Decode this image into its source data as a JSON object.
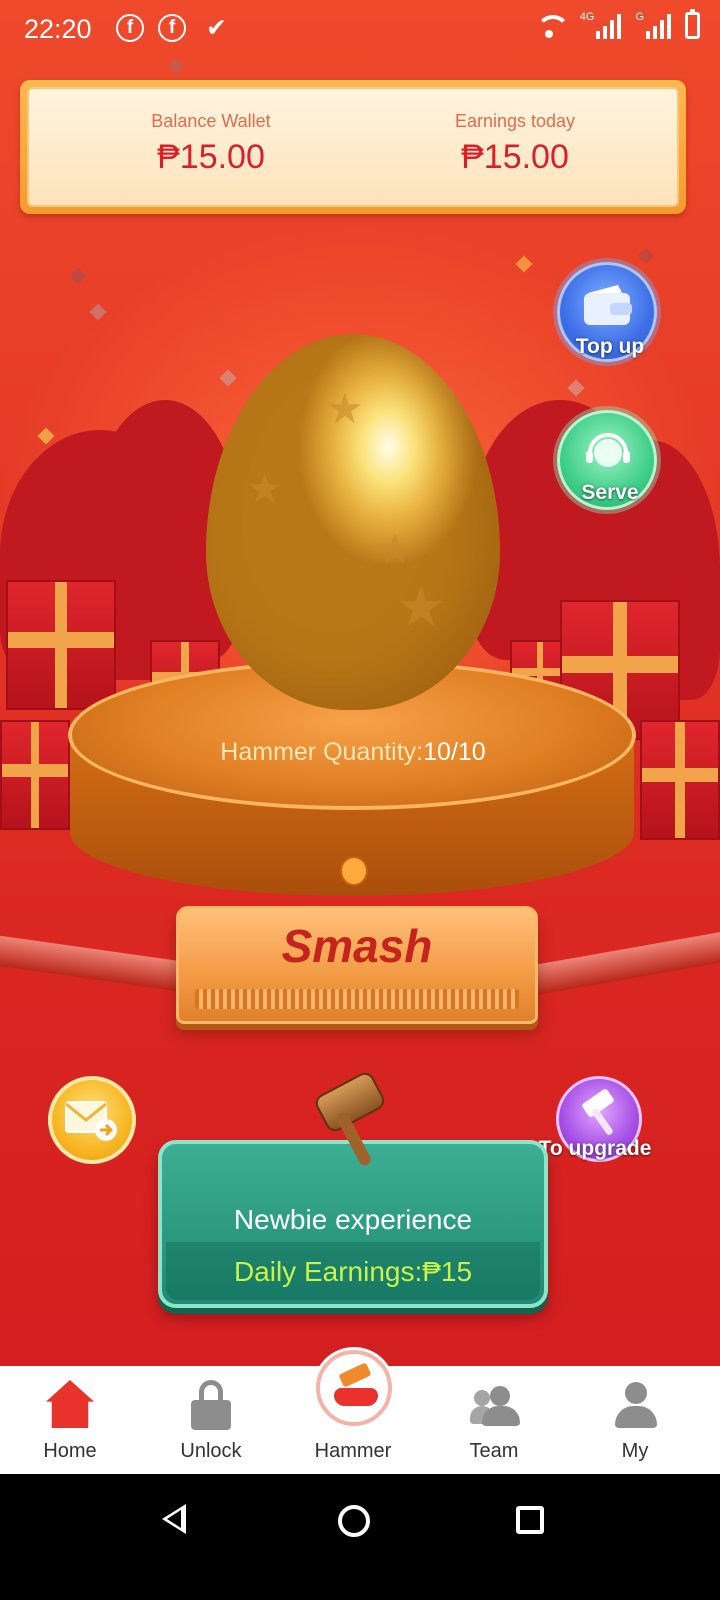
{
  "status_bar": {
    "time": "22:20",
    "notification_icons": [
      "facebook-icon",
      "facebook-icon",
      "download-done-icon"
    ],
    "network_labels": [
      "4G",
      "G"
    ]
  },
  "wallet": {
    "balance_label": "Balance Wallet",
    "balance_value": "₱15.00",
    "earnings_label": "Earnings today",
    "earnings_value": "₱15.00"
  },
  "side_buttons": {
    "top_up": "Top up",
    "serve": "Serve",
    "to_upgrade": "To upgrade"
  },
  "game": {
    "hammer_quantity_label": "Hammer Quantity:",
    "hammer_quantity_value": "10/10",
    "smash_label": "Smash"
  },
  "plan": {
    "title": "Newbie experience",
    "daily_earnings": "Daily Earnings:₱15"
  },
  "tabs": [
    {
      "label": "Home",
      "icon": "home-icon",
      "active": true
    },
    {
      "label": "Unlock",
      "icon": "lock-icon"
    },
    {
      "label": "Hammer",
      "icon": "hammer-icon"
    },
    {
      "label": "Team",
      "icon": "team-icon"
    },
    {
      "label": "My",
      "icon": "user-icon"
    }
  ],
  "colors": {
    "background_red": "#e53a26",
    "accent_gold": "#f59a2f",
    "price_red": "#d8202a",
    "plan_green": "#1f8a72",
    "daily_earnings_text": "#c7f34a",
    "active_tab": "#e8322b"
  }
}
